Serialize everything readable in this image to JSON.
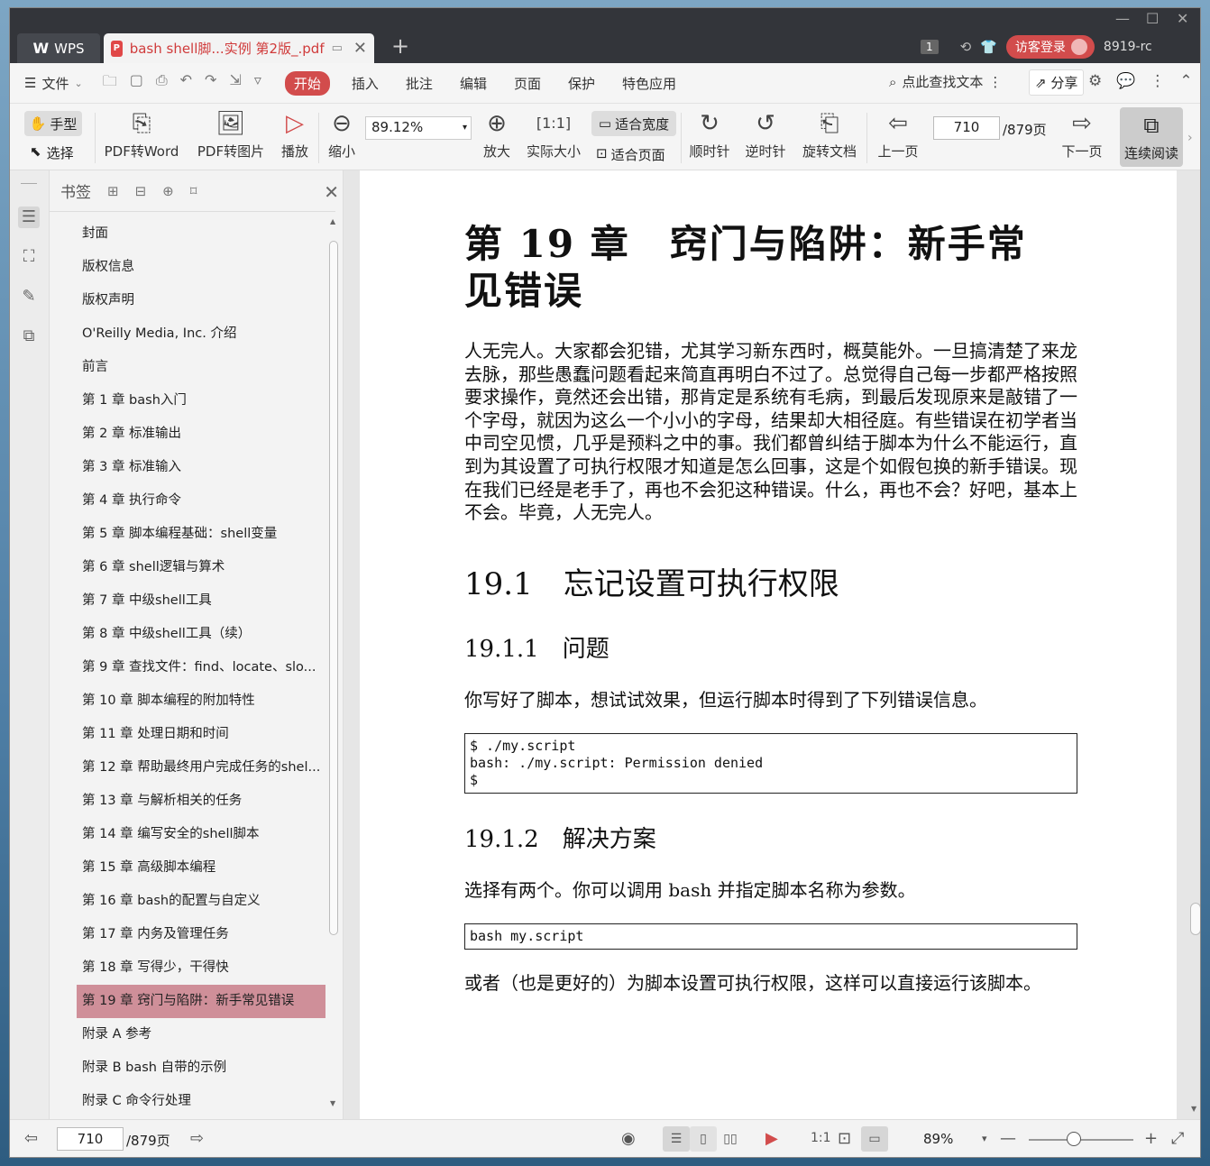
{
  "titlebar": {
    "app_label": "WPS",
    "tab_title": "bash shell脚...实例 第2版_.pdf",
    "badge": "1",
    "login_label": "访客登录",
    "user_id": "8919-rc"
  },
  "menubar": {
    "file": "文件",
    "items": [
      "开始",
      "插入",
      "批注",
      "编辑",
      "页面",
      "保护",
      "特色应用"
    ],
    "search_placeholder": "点此查找文本",
    "share": "分享"
  },
  "toolbar": {
    "hand": "手型",
    "select": "选择",
    "pdf_word": "PDF转Word",
    "pdf_img": "PDF转图片",
    "play": "播放",
    "zoom_out": "缩小",
    "zoom_value": "89.12%",
    "zoom_in": "放大",
    "actual_size": "实际大小",
    "fit_width": "适合宽度",
    "fit_page": "适合页面",
    "clockwise": "顺时针",
    "counter_clockwise": "逆时针",
    "rotate_doc": "旋转文档",
    "prev_page": "上一页",
    "current_page": "710",
    "total_pages": "/879页",
    "next_page": "下一页",
    "continuous": "连续阅读"
  },
  "bookmarks": {
    "title": "书签",
    "items": [
      "封面",
      "版权信息",
      "版权声明",
      "O'Reilly Media, Inc. 介绍",
      "前言",
      "第 1 章 bash入门",
      "第 2 章 标准输出",
      "第 3 章 标准输入",
      "第 4 章 执行命令",
      "第 5 章 脚本编程基础：shell变量",
      "第 6 章 shell逻辑与算术",
      "第 7 章 中级shell工具",
      "第 8 章 中级shell工具（续）",
      "第 9 章 查找文件：find、locate、slo...",
      "第 10 章 脚本编程的附加特性",
      "第 11 章 处理日期和时间",
      "第 12 章 帮助最终用户完成任务的shel...",
      "第 13 章 与解析相关的任务",
      "第 14 章 编写安全的shell脚本",
      "第 15 章 高级脚本编程",
      "第 16 章 bash的配置与自定义",
      "第 17 章 内务及管理任务",
      "第 18 章 写得少，干得快",
      "第 19 章 窍门与陷阱：新手常见错误",
      "附录 A 参考",
      "附录 B bash 自带的示例",
      "附录 C 命令行处理"
    ],
    "active_index": 23
  },
  "document": {
    "chapter_title_line1": "第 19 章　窍门与陷阱：新手常",
    "chapter_title_line2": "见错误",
    "intro": "人无完人。大家都会犯错，尤其学习新东西时，概莫能外。一旦搞清楚了来龙去脉，那些愚蠢问题看起来简直再明白不过了。总觉得自己每一步都严格按照要求操作，竟然还会出错，那肯定是系统有毛病，到最后发现原来是敲错了一个字母，就因为这么一个小小的字母，结果却大相径庭。有些错误在初学者当中司空见惯，几乎是预料之中的事。我们都曾纠结于脚本为什么不能运行，直到为其设置了可执行权限才知道是怎么回事，这是个如假包换的新手错误。现在我们已经是老手了，再也不会犯这种错误。什么，再也不会？好吧，基本上不会。毕竟，人无完人。",
    "section": "19.1　忘记设置可执行权限",
    "sub1": "19.1.1　问题",
    "sub1_text": "你写好了脚本，想试试效果，但运行脚本时得到了下列错误信息。",
    "code1": "$ ./my.script\nbash: ./my.script: Permission denied\n$",
    "sub2": "19.1.2　解决方案",
    "sub2_text": "选择有两个。你可以调用 bash 并指定脚本名称为参数。",
    "code2": "bash my.script",
    "sub2_text2": "或者（也是更好的）为脚本设置可执行权限，这样可以直接运行该脚本。"
  },
  "statusbar": {
    "current_page": "710",
    "total_pages": "/879页",
    "zoom": "89%"
  }
}
